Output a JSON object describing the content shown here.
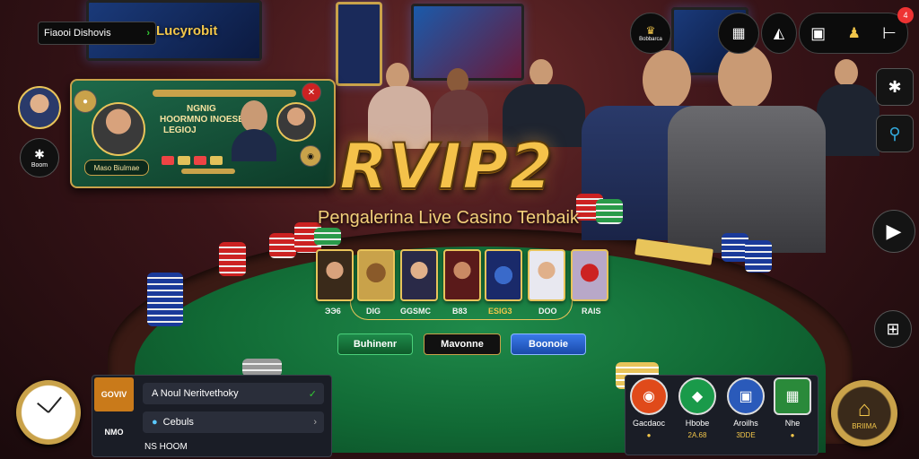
{
  "top_banner": {
    "label": "Fiaooi Dishovis",
    "logo_text": "Lucyrobit"
  },
  "lobby_card": {
    "line1": "NGNIG",
    "line2": "HOORMNO INOESE",
    "line3": "LEGIOJ",
    "name_left": "Maso Biulmae",
    "left_badge": "Boom"
  },
  "hero": {
    "title": "RVIP2",
    "subtitle": "Pengalerina Live Casino Tenbaik"
  },
  "games": [
    {
      "label": "ЭЭ6"
    },
    {
      "label": "DIG"
    },
    {
      "label": "GGSMC"
    },
    {
      "label": "B83"
    },
    {
      "label": "ESIG3"
    },
    {
      "label": "DOO"
    },
    {
      "label": "RAIS"
    }
  ],
  "cta_buttons": [
    {
      "label": "Buhinenr"
    },
    {
      "label": "Mavonne"
    },
    {
      "label": "Boonoie"
    }
  ],
  "bottom_panel": {
    "tab_top": "GOVIV",
    "tab_bottom": "NMO",
    "row1": "A Noul Neritvethoky",
    "row2": "Cebuls",
    "row3": "NS HOOM"
  },
  "actions": [
    {
      "label": "Gacdaoc",
      "coin": "●",
      "icon": "record-icon",
      "color": "#e04a1a"
    },
    {
      "label": "Hbobe",
      "coin": "2A.68",
      "icon": "diamond-icon",
      "color": "#1a9a4a"
    },
    {
      "label": "Aroilhs",
      "coin": "3DDE",
      "icon": "cards-icon",
      "color": "#2a5aba"
    },
    {
      "label": "Nhe",
      "coin": "●",
      "icon": "gift-icon",
      "color": "#2a8a3a"
    }
  ],
  "home_button": {
    "label": "BRIIMA"
  },
  "top_right": {
    "badge1": "Bobbarca",
    "notif": "4"
  },
  "colors": {
    "gold": "#f4c24a",
    "felt": "#116a35",
    "panel": "#1a1d26"
  }
}
